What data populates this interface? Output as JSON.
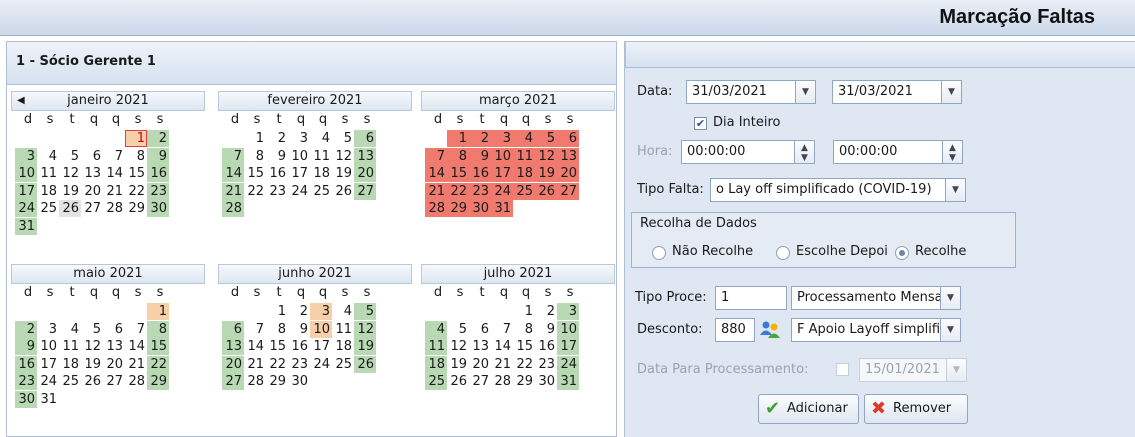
{
  "app": {
    "title": "Marcação Faltas"
  },
  "left": {
    "header": "1 - Sócio Gerente 1"
  },
  "calendar": {
    "dow": [
      "d",
      "s",
      "t",
      "q",
      "q",
      "s",
      "s"
    ],
    "months": [
      {
        "name": "janeiro 2021",
        "first": 5,
        "days": 31,
        "marks": {
          "1": "today",
          "2": "green",
          "3": "green",
          "9": "green",
          "10": "green",
          "16": "green",
          "17": "green",
          "23": "green",
          "24": "green",
          "26": "gray",
          "30": "green",
          "31": "green"
        }
      },
      {
        "name": "fevereiro 2021",
        "first": 1,
        "days": 28,
        "marks": {
          "6": "green",
          "7": "green",
          "13": "green",
          "14": "green",
          "20": "green",
          "21": "green",
          "27": "green",
          "28": "green"
        }
      },
      {
        "name": "março 2021",
        "first": 1,
        "days": 31,
        "marks": {
          "1": "red",
          "2": "red",
          "3": "red",
          "4": "red",
          "5": "red",
          "6": "red",
          "7": "red",
          "8": "red",
          "9": "red",
          "10": "red",
          "11": "red",
          "12": "red",
          "13": "red",
          "14": "red",
          "15": "red",
          "16": "red",
          "17": "red",
          "18": "red",
          "19": "red",
          "20": "red",
          "21": "red",
          "22": "red",
          "23": "red",
          "24": "red",
          "25": "red",
          "26": "red",
          "27": "red",
          "28": "red",
          "29": "red",
          "30": "red",
          "31": "red"
        }
      },
      {
        "name": "maio 2021",
        "first": 6,
        "days": 31,
        "marks": {
          "1": "peach",
          "2": "green",
          "8": "green",
          "9": "green",
          "15": "green",
          "16": "green",
          "22": "green",
          "23": "green",
          "29": "green",
          "30": "green"
        }
      },
      {
        "name": "junho 2021",
        "first": 2,
        "days": 30,
        "marks": {
          "3": "peach",
          "5": "green",
          "6": "green",
          "10": "peach",
          "12": "green",
          "13": "green",
          "19": "green",
          "20": "green",
          "26": "green",
          "27": "green"
        }
      },
      {
        "name": "julho 2021",
        "first": 4,
        "days": 31,
        "marks": {
          "3": "green",
          "4": "green",
          "10": "green",
          "11": "green",
          "17": "green",
          "18": "green",
          "24": "green",
          "25": "green",
          "31": "green"
        }
      }
    ]
  },
  "form": {
    "data_label": "Data:",
    "date_from": "31/03/2021",
    "date_to": "31/03/2021",
    "dia_inteiro_label": "Dia Inteiro",
    "dia_inteiro_checked": true,
    "hora_label": "Hora:",
    "hora_from": "00:00:00",
    "hora_to": "00:00:00",
    "tipo_falta_label": "Tipo Falta:",
    "tipo_falta_value": "o Lay off simplificado (COVID-19)",
    "recolha_title": "Recolha de Dados",
    "radio_options": [
      "Não Recolhe",
      "Escolhe Depoi",
      "Recolhe"
    ],
    "radio_selected": 2,
    "tipo_proce_label": "Tipo Proce:",
    "tipo_proce_code": "1",
    "tipo_proce_value": "Processamento Mensa",
    "desconto_label": "Desconto:",
    "desconto_code": "880",
    "desconto_value": "F Apoio Layoff simplifi",
    "data_proc_label": "Data Para Processamento:",
    "data_proc_value": "15/01/2021",
    "add_label": "Adicionar",
    "remove_label": "Remover"
  }
}
